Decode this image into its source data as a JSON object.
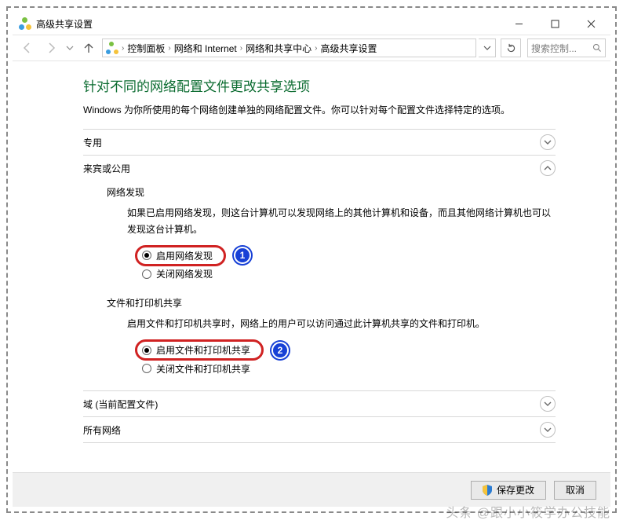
{
  "window": {
    "title": "高级共享设置"
  },
  "breadcrumb": {
    "items": [
      "控制面板",
      "网络和 Internet",
      "网络和共享中心",
      "高级共享设置"
    ]
  },
  "search": {
    "placeholder": "搜索控制..."
  },
  "heading": "针对不同的网络配置文件更改共享选项",
  "description": "Windows 为你所使用的每个网络创建单独的网络配置文件。你可以针对每个配置文件选择特定的选项。",
  "sections": {
    "private": {
      "label": "专用",
      "expanded": false
    },
    "guest": {
      "label": "来宾或公用",
      "expanded": true,
      "network_discovery": {
        "title": "网络发现",
        "explain": "如果已启用网络发现，则这台计算机可以发现网络上的其他计算机和设备，而且其他网络计算机也可以发现这台计算机。",
        "on_label": "启用网络发现",
        "off_label": "关闭网络发现",
        "badge": "1"
      },
      "file_printer": {
        "title": "文件和打印机共享",
        "explain": "启用文件和打印机共享时，网络上的用户可以访问通过此计算机共享的文件和打印机。",
        "on_label": "启用文件和打印机共享",
        "off_label": "关闭文件和打印机共享",
        "badge": "2"
      }
    },
    "domain": {
      "label": "域 (当前配置文件)",
      "expanded": false
    },
    "all": {
      "label": "所有网络",
      "expanded": false
    }
  },
  "footer": {
    "save": "保存更改",
    "cancel": "取消"
  },
  "watermark": "头条 @跟小小筱学办公技能"
}
